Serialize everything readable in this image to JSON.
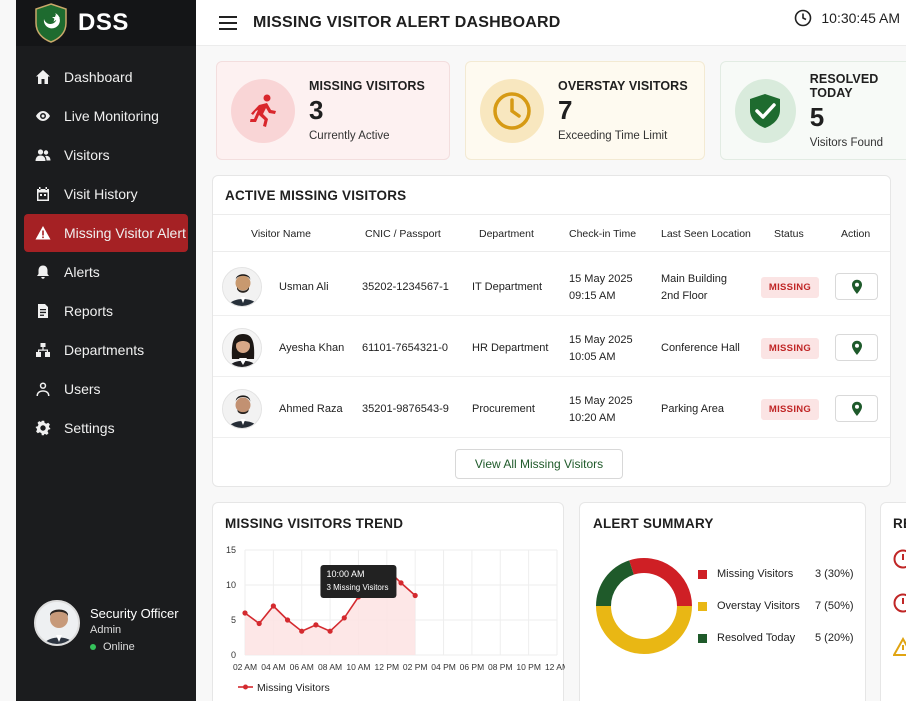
{
  "brand": {
    "name": "DSS"
  },
  "header": {
    "title": "MISSING VISITOR ALERT DASHBOARD",
    "time": "10:30:45 AM"
  },
  "sidebar": {
    "items": [
      {
        "label": "Dashboard",
        "icon": "home-icon"
      },
      {
        "label": "Live Monitoring",
        "icon": "eye-icon"
      },
      {
        "label": "Visitors",
        "icon": "users-icon"
      },
      {
        "label": "Visit History",
        "icon": "calendar-icon"
      },
      {
        "label": "Missing Visitor Alert",
        "icon": "warning-icon",
        "active": true
      },
      {
        "label": "Alerts",
        "icon": "bell-icon"
      },
      {
        "label": "Reports",
        "icon": "report-icon"
      },
      {
        "label": "Departments",
        "icon": "building-icon"
      },
      {
        "label": "Users",
        "icon": "user-icon"
      },
      {
        "label": "Settings",
        "icon": "gear-icon"
      }
    ],
    "user": {
      "name": "Security Officer",
      "role": "Admin",
      "status": "Online"
    }
  },
  "stats": [
    {
      "title": "MISSING VISITORS",
      "value": "3",
      "sub": "Currently Active",
      "icon": "running-person-icon",
      "color": "#d9262c",
      "bg": "#fdecec"
    },
    {
      "title": "OVERSTAY VISITORS",
      "value": "7",
      "sub": "Exceeding Time Limit",
      "icon": "clock-icon",
      "color": "#d69a14",
      "bg": "#fdf5e3"
    },
    {
      "title": "RESOLVED TODAY",
      "value": "5",
      "sub": "Visitors Found",
      "icon": "shield-check-icon",
      "color": "#1e6b2f",
      "bg": "#eaf4ec"
    }
  ],
  "table": {
    "title": "ACTIVE MISSING VISITORS",
    "headers": [
      "Visitor Name",
      "CNIC / Passport",
      "Department",
      "Check-in Time",
      "Last Seen Location",
      "Status",
      "Action"
    ],
    "rows": [
      {
        "name": "Usman Ali",
        "cnic": "35202-1234567-1",
        "dept": "IT Department",
        "date": "15 May 2025",
        "time": "09:15 AM",
        "loc1": "Main Building",
        "loc2": "2nd Floor",
        "status": "MISSING"
      },
      {
        "name": "Ayesha Khan",
        "cnic": "61101-7654321-0",
        "dept": "HR Department",
        "date": "15 May 2025",
        "time": "10:05 AM",
        "loc1": "Conference Hall",
        "loc2": "",
        "status": "MISSING"
      },
      {
        "name": "Ahmed Raza",
        "cnic": "35201-9876543-9",
        "dept": "Procurement",
        "date": "15 May 2025",
        "time": "10:20 AM",
        "loc1": "Parking Area",
        "loc2": "",
        "status": "MISSING"
      }
    ],
    "view_all": "View All Missing Visitors"
  },
  "trend": {
    "title": "MISSING VISITORS TREND",
    "tooltip_time": "10:00 AM",
    "tooltip_text": "3 Missing Visitors"
  },
  "summary": {
    "title": "ALERT SUMMARY",
    "items": [
      {
        "label": "Missing Visitors",
        "value": "3 (30%)",
        "color": "#cf1f25"
      },
      {
        "label": "Overstay Visitors",
        "value": "7 (50%)",
        "color": "#e9b714"
      },
      {
        "label": "Resolved Today",
        "value": "5 (20%)",
        "color": "#1f5a2a"
      }
    ]
  },
  "right_panel": {
    "title_fragment": "RE"
  },
  "chart_data": [
    {
      "type": "line",
      "title": "MISSING VISITORS TREND",
      "x": [
        "02 AM",
        "03 AM",
        "04 AM",
        "05 AM",
        "06 AM",
        "07 AM",
        "08 AM",
        "09 AM",
        "10 AM",
        "11 AM",
        "12 PM",
        "01 PM",
        "02 PM",
        "03 PM",
        "04 PM",
        "05 PM",
        "06 PM",
        "07 PM",
        "08 PM",
        "09 PM",
        "10 PM",
        "11 PM",
        "12 AM"
      ],
      "xticks": [
        "02 AM",
        "04 AM",
        "06 AM",
        "08 AM",
        "10 AM",
        "12 PM",
        "02 PM",
        "04 PM",
        "06 PM",
        "08 PM",
        "10 PM",
        "12 AM"
      ],
      "series": [
        {
          "name": "Missing Visitors",
          "values": [
            6,
            4.5,
            7,
            5,
            3.4,
            4.3,
            3.4,
            5.3,
            8.3,
            10.5,
            12.3,
            10.3,
            8.5
          ]
        }
      ],
      "series_x": [
        "02 AM",
        "03 AM",
        "04 AM",
        "05 AM",
        "06 AM",
        "07 AM",
        "08 AM",
        "09 AM",
        "10 AM",
        "11 AM",
        "12 PM",
        "01 PM",
        "02 PM"
      ],
      "yticks": [
        0,
        5,
        10,
        15
      ],
      "ylim": [
        0,
        15
      ],
      "grid": true,
      "legend": "bottom-left"
    },
    {
      "type": "pie",
      "title": "ALERT SUMMARY",
      "categories": [
        "Missing Visitors",
        "Overstay Visitors",
        "Resolved Today"
      ],
      "values": [
        30,
        50,
        20
      ],
      "donut": true
    }
  ]
}
